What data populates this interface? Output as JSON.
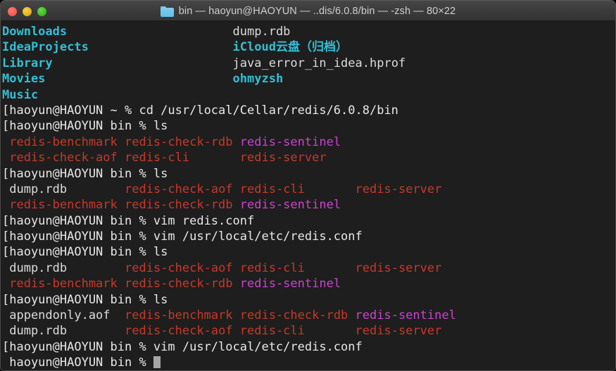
{
  "window": {
    "title": "bin — haoyun@HAOYUN — ..dis/6.0.8/bin — -zsh — 80×22",
    "folder_icon": "folder-icon",
    "traffic_lights": [
      {
        "name": "close-button",
        "color": "#fc5d55"
      },
      {
        "name": "minimize-button",
        "color": "#e9b81f"
      },
      {
        "name": "maximize-button",
        "color": "#41c222"
      }
    ]
  },
  "theme": {
    "background": "#1e1e1e",
    "foreground": "#d8d8d8",
    "directory": "#35bed4",
    "executable": "#c8392a",
    "symlink": "#cc43cc",
    "cursor": "#a6a6a6",
    "titlebar": "#3b3b3b"
  },
  "terminal": {
    "columns": 80,
    "rows": 22,
    "shell": "-zsh",
    "user": "haoyun",
    "host": "HAOYUN",
    "lines": [
      {
        "id": "ls-home-row-1",
        "segments": [
          {
            "text": "Downloads",
            "class": "c-dir"
          },
          {
            "text": "                       ",
            "class": "c-plain"
          },
          {
            "text": "dump.rdb",
            "class": "c-plain"
          }
        ]
      },
      {
        "id": "ls-home-row-2",
        "segments": [
          {
            "text": "IdeaProjects",
            "class": "c-dir"
          },
          {
            "text": "                    ",
            "class": "c-plain"
          },
          {
            "text": "iCloud云盘（归档）",
            "class": "c-dir"
          }
        ]
      },
      {
        "id": "ls-home-row-3",
        "segments": [
          {
            "text": "Library",
            "class": "c-dir"
          },
          {
            "text": "                         ",
            "class": "c-plain"
          },
          {
            "text": "java_error_in_idea.hprof",
            "class": "c-plain"
          }
        ]
      },
      {
        "id": "ls-home-row-4",
        "segments": [
          {
            "text": "Movies",
            "class": "c-dir"
          },
          {
            "text": "                          ",
            "class": "c-plain"
          },
          {
            "text": "ohmyzsh",
            "class": "c-dir"
          }
        ]
      },
      {
        "id": "ls-home-row-5",
        "segments": [
          {
            "text": "Music",
            "class": "c-dir"
          }
        ]
      },
      {
        "id": "prompt-cd",
        "segments": [
          {
            "text": "[haoyun@HAOYUN ~ % cd /usr/local/Cellar/redis/6.0.8/bin",
            "class": "c-prompt"
          }
        ]
      },
      {
        "id": "prompt-ls-1",
        "segments": [
          {
            "text": "[haoyun@HAOYUN bin % ls",
            "class": "c-prompt"
          }
        ]
      },
      {
        "id": "ls-bin-1-row-1",
        "segments": [
          {
            "text": " redis-benchmark redis-check-rdb ",
            "class": "c-exec"
          },
          {
            "text": "redis-sentinel",
            "class": "c-link"
          }
        ]
      },
      {
        "id": "ls-bin-1-row-2",
        "segments": [
          {
            "text": " redis-check-aof redis-cli       redis-server",
            "class": "c-exec"
          }
        ]
      },
      {
        "id": "prompt-ls-2",
        "segments": [
          {
            "text": "[haoyun@HAOYUN bin % ls",
            "class": "c-prompt"
          }
        ]
      },
      {
        "id": "ls-bin-2-row-1",
        "segments": [
          {
            "text": " dump.rdb",
            "class": "c-plain"
          },
          {
            "text": "        ",
            "class": "c-plain"
          },
          {
            "text": "redis-check-aof redis-cli       redis-server",
            "class": "c-exec"
          }
        ]
      },
      {
        "id": "ls-bin-2-row-2",
        "segments": [
          {
            "text": " redis-benchmark redis-check-rdb ",
            "class": "c-exec"
          },
          {
            "text": "redis-sentinel",
            "class": "c-link"
          }
        ]
      },
      {
        "id": "prompt-vim-1",
        "segments": [
          {
            "text": "[haoyun@HAOYUN bin % vim redis.conf",
            "class": "c-prompt"
          }
        ]
      },
      {
        "id": "prompt-vim-2",
        "segments": [
          {
            "text": "[haoyun@HAOYUN bin % vim /usr/local/etc/redis.conf",
            "class": "c-prompt"
          }
        ]
      },
      {
        "id": "prompt-ls-3",
        "segments": [
          {
            "text": "[haoyun@HAOYUN bin % ls",
            "class": "c-prompt"
          }
        ]
      },
      {
        "id": "ls-bin-3-row-1",
        "segments": [
          {
            "text": " dump.rdb",
            "class": "c-plain"
          },
          {
            "text": "        ",
            "class": "c-plain"
          },
          {
            "text": "redis-check-aof redis-cli       redis-server",
            "class": "c-exec"
          }
        ]
      },
      {
        "id": "ls-bin-3-row-2",
        "segments": [
          {
            "text": " redis-benchmark redis-check-rdb ",
            "class": "c-exec"
          },
          {
            "text": "redis-sentinel",
            "class": "c-link"
          }
        ]
      },
      {
        "id": "prompt-ls-4",
        "segments": [
          {
            "text": "[haoyun@HAOYUN bin % ls",
            "class": "c-prompt"
          }
        ]
      },
      {
        "id": "ls-bin-4-row-1",
        "segments": [
          {
            "text": " appendonly.aof",
            "class": "c-plain"
          },
          {
            "text": "  ",
            "class": "c-plain"
          },
          {
            "text": "redis-benchmark redis-check-rdb ",
            "class": "c-exec"
          },
          {
            "text": "redis-sentinel",
            "class": "c-link"
          }
        ]
      },
      {
        "id": "ls-bin-4-row-2",
        "segments": [
          {
            "text": " dump.rdb",
            "class": "c-plain"
          },
          {
            "text": "        ",
            "class": "c-plain"
          },
          {
            "text": "redis-check-aof redis-cli       redis-server",
            "class": "c-exec"
          }
        ]
      },
      {
        "id": "prompt-vim-3",
        "segments": [
          {
            "text": "[haoyun@HAOYUN bin % vim /usr/local/etc/redis.conf",
            "class": "c-prompt"
          }
        ]
      },
      {
        "id": "prompt-active",
        "cursor": true,
        "segments": [
          {
            "text": " haoyun@HAOYUN bin % ",
            "class": "c-prompt"
          }
        ]
      }
    ]
  }
}
